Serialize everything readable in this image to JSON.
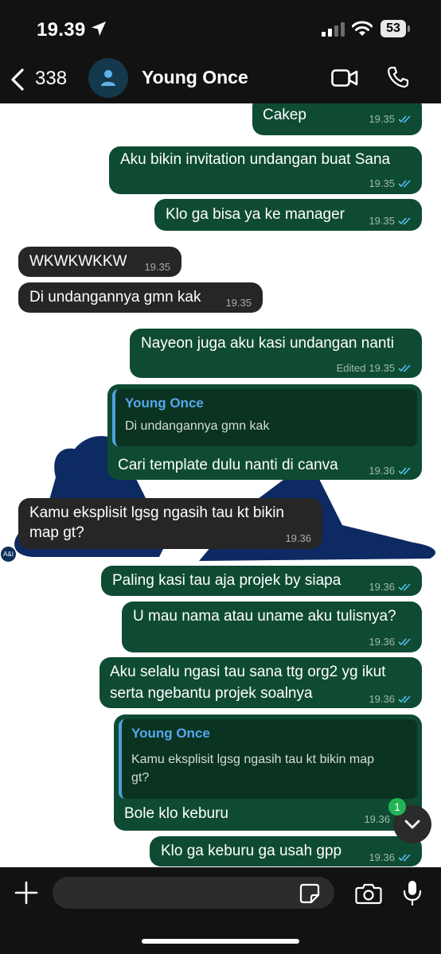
{
  "status_bar": {
    "time": "19.39",
    "battery": "53"
  },
  "header": {
    "back_count": "338",
    "contact_name": "Young Once"
  },
  "messages": [
    {
      "text": "Cakep",
      "time": "19.35"
    },
    {
      "text": "Aku bikin invitation undangan buat Sana",
      "time": "19.35"
    },
    {
      "text": "Klo ga bisa ya ke manager",
      "time": "19.35"
    },
    {
      "text": "WKWKWKKW",
      "time": "19.35"
    },
    {
      "text": "Di undangannya gmn kak",
      "time": "19.35"
    },
    {
      "text": "Nayeon juga aku kasi undangan nanti",
      "time": "19.35",
      "edited": "Edited"
    },
    {
      "quote_name": "Young Once",
      "quote_text": "Di undangannya gmn kak",
      "text": "Cari template dulu nanti di canva",
      "time": "19.36"
    },
    {
      "line1": "Kamu eksplisit lgsg ngasih tau kt bikin",
      "line2": "map gt?",
      "time": "19.36"
    },
    {
      "text": "Paling kasi tau aja projek by siapa",
      "time": "19.36"
    },
    {
      "text": "U mau nama atau uname aku tulisnya?",
      "time": "19.36"
    },
    {
      "line1": "Aku selalu ngasi tau sana ttg org2 yg ikut",
      "line2": "serta ngebantu projek soalnya",
      "time": "19.36"
    },
    {
      "quote_name": "Young Once",
      "quote_line1": "Kamu eksplisit lgsg ngasih tau kt bikin map",
      "quote_line2": "gt?",
      "text": "Bole klo keburu",
      "time": "19.36"
    },
    {
      "text": "Klo ga keburu ga usah gpp",
      "time": "19.36"
    }
  ],
  "reply_avatar_label": "A&I",
  "unread_count": "1",
  "input": {
    "placeholder": ""
  },
  "colors": {
    "outgoing": "#0f4b33",
    "incoming": "#262626",
    "wallpaper_figure": "#0d2a63",
    "read_ticks": "#53bdeb"
  },
  "icons": [
    "location-arrow-icon",
    "signal-icon",
    "wifi-icon",
    "battery-icon",
    "back-chevron-icon",
    "person-icon",
    "video-call-icon",
    "phone-icon",
    "double-check-icon",
    "chevron-down-icon",
    "plus-icon",
    "sticker-icon",
    "camera-icon",
    "mic-icon"
  ]
}
